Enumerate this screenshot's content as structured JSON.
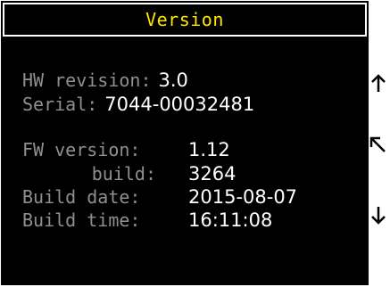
{
  "title": "Version",
  "hardware": {
    "revision_label": "HW revision:",
    "revision_value": "3.0",
    "serial_label": "Serial:",
    "serial_value": "7044-00032481"
  },
  "firmware": {
    "version_label": "FW version:",
    "version_value": "1.12",
    "build_label": "build:",
    "build_value": "3264",
    "date_label": "Build date:",
    "date_value": "2015-08-07",
    "time_label": "Build time:",
    "time_value": "16:11:08"
  },
  "side_buttons": [
    {
      "icon": "arrow-up-icon"
    },
    {
      "icon": "arrow-up-left-icon"
    },
    {
      "icon": "arrow-down-icon"
    }
  ],
  "colors": {
    "background": "#000000",
    "title": "#ffe500",
    "label": "#8f8f8f",
    "value": "#ffffff",
    "frame": "#ffffff"
  }
}
